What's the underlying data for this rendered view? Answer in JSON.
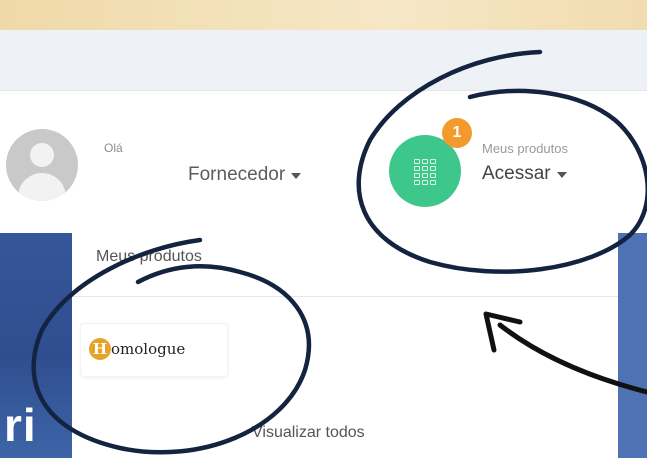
{
  "header": {
    "greeting": "Olá",
    "user_menu_label": "Fornecedor",
    "products_caption": "Meus produtos",
    "products_menu_label": "Acessar",
    "notification_count": "1"
  },
  "dropdown": {
    "title": "Meus produtos",
    "items": [
      {
        "logo_initial": "H",
        "logo_text": "omologue"
      }
    ],
    "view_all_label": "Visualizar todos"
  },
  "background": {
    "hero_text": "ri"
  },
  "colors": {
    "app_button": "#3ec78a",
    "badge": "#f39a2d",
    "hero_blue": "#36569a",
    "annotation_ink": "#14233f"
  },
  "icons": [
    "avatar-icon",
    "apps-grid-icon",
    "caret-down-icon",
    "arrow-annotation"
  ]
}
